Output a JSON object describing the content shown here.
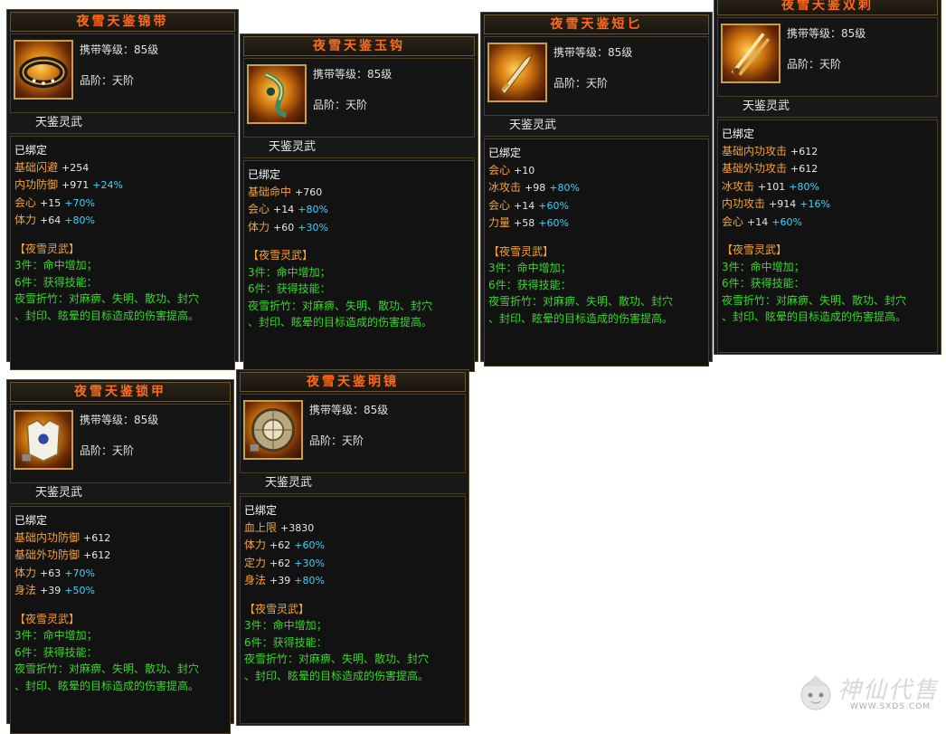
{
  "cards": [
    {
      "title": "夜雪天鉴锦带",
      "level": "携带等级：85级",
      "grade": "品阶：天阶",
      "set_label": "天鉴灵武",
      "bound": "已绑定",
      "stats": [
        {
          "name": "基础闪避",
          "value": "+254",
          "pct": ""
        },
        {
          "name": "内功防御",
          "value": "+971",
          "pct": "+24%"
        },
        {
          "name": "会心",
          "value": "+15",
          "pct": "+70%"
        },
        {
          "name": "体力",
          "value": "+64",
          "pct": "+80%"
        }
      ],
      "set_head": "【夜雪灵武】",
      "set_lines": [
        "3件：命中增加；",
        "6件：获得技能：",
        "夜雪折竹：对麻痹、失明、散功、封穴",
        "、封印、眩晕的目标造成的伤害提高。"
      ],
      "icon": "belt-icon"
    },
    {
      "title": "夜雪天鉴玉钩",
      "level": "携带等级：85级",
      "grade": "品阶：天阶",
      "set_label": "天鉴灵武",
      "bound": "已绑定",
      "stats": [
        {
          "name": "基础命中",
          "value": "+760",
          "pct": ""
        },
        {
          "name": "会心",
          "value": "+14",
          "pct": "+80%"
        },
        {
          "name": "体力",
          "value": "+60",
          "pct": "+30%"
        }
      ],
      "set_head": "【夜雪灵武】",
      "set_lines": [
        "3件：命中增加；",
        "6件：获得技能：",
        "夜雪折竹：对麻痹、失明、散功、封穴",
        "、封印、眩晕的目标造成的伤害提高。"
      ],
      "icon": "hook-icon"
    },
    {
      "title": "夜雪天鉴短匕",
      "level": "携带等级：85级",
      "grade": "品阶：天阶",
      "set_label": "天鉴灵武",
      "bound": "已绑定",
      "stats": [
        {
          "name": "会心",
          "value": "+10",
          "pct": ""
        },
        {
          "name": "冰攻击",
          "value": "+98",
          "pct": "+80%"
        },
        {
          "name": "会心",
          "value": "+14",
          "pct": "+60%"
        },
        {
          "name": "力量",
          "value": "+58",
          "pct": "+60%"
        }
      ],
      "set_head": "【夜雪灵武】",
      "set_lines": [
        "3件：命中增加；",
        "6件：获得技能：",
        "夜雪折竹：对麻痹、失明、散功、封穴",
        "、封印、眩晕的目标造成的伤害提高。"
      ],
      "icon": "dagger-icon"
    },
    {
      "title": "夜雪天鉴双刺",
      "level": "携带等级：85级",
      "grade": "品阶：天阶",
      "set_label": "天鉴灵武",
      "bound": "已绑定",
      "stats": [
        {
          "name": "基础内功攻击",
          "value": "+612",
          "pct": ""
        },
        {
          "name": "基础外功攻击",
          "value": "+612",
          "pct": ""
        },
        {
          "name": "冰攻击",
          "value": "+101",
          "pct": "+80%"
        },
        {
          "name": "内功攻击",
          "value": "+914",
          "pct": "+16%"
        },
        {
          "name": "会心",
          "value": "+14",
          "pct": "+60%"
        }
      ],
      "set_head": "【夜雪灵武】",
      "set_lines": [
        "3件：命中增加；",
        "6件：获得技能：",
        "夜雪折竹：对麻痹、失明、散功、封穴",
        "、封印、眩晕的目标造成的伤害提高。"
      ],
      "icon": "twin-spikes-icon"
    },
    {
      "title": "夜雪天鉴锁甲",
      "level": "携带等级：85级",
      "grade": "品阶：天阶",
      "set_label": "天鉴灵武",
      "bound": "已绑定",
      "stats": [
        {
          "name": "基础内功防御",
          "value": "+612",
          "pct": ""
        },
        {
          "name": "基础外功防御",
          "value": "+612",
          "pct": ""
        },
        {
          "name": "体力",
          "value": "+63",
          "pct": "+70%"
        },
        {
          "name": "身法",
          "value": "+39",
          "pct": "+50%"
        }
      ],
      "set_head": "【夜雪灵武】",
      "set_lines": [
        "3件：命中增加；",
        "6件：获得技能：",
        "夜雪折竹：对麻痹、失明、散功、封穴",
        "、封印、眩晕的目标造成的伤害提高。"
      ],
      "icon": "armor-icon"
    },
    {
      "title": "夜雪天鉴明镜",
      "level": "携带等级：85级",
      "grade": "品阶：天阶",
      "set_label": "天鉴灵武",
      "bound": "已绑定",
      "stats": [
        {
          "name": "血上限",
          "value": "+3830",
          "pct": ""
        },
        {
          "name": "体力",
          "value": "+62",
          "pct": "+60%"
        },
        {
          "name": "定力",
          "value": "+62",
          "pct": "+30%"
        },
        {
          "name": "身法",
          "value": "+39",
          "pct": "+80%"
        }
      ],
      "set_head": "【夜雪灵武】",
      "set_lines": [
        "3件：命中增加；",
        "6件：获得技能：",
        "夜雪折竹：对麻痹、失明、散功、封穴",
        "、封印、眩晕的目标造成的伤害提高。"
      ],
      "icon": "mirror-icon"
    }
  ],
  "watermark": {
    "text": "神仙代售",
    "url": "WWW.SXDS.COM"
  }
}
